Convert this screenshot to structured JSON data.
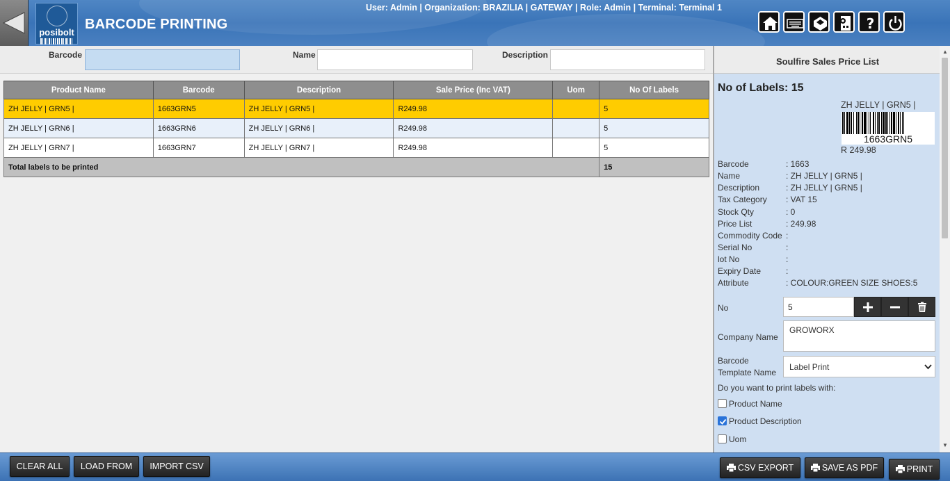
{
  "header": {
    "title": "BARCODE PRINTING",
    "logo_text": "posibolt",
    "user_info": "User: Admin | Organization: BRAZILIA | GATEWAY | Role: Admin | Terminal: Terminal 1",
    "icons": [
      "home-icon",
      "keyboard-icon",
      "catalog-icon",
      "calculator-settings-icon",
      "help-icon",
      "power-icon"
    ]
  },
  "filters": {
    "barcode_label": "Barcode",
    "barcode_value": "",
    "name_label": "Name",
    "name_value": "",
    "description_label": "Description",
    "description_value": ""
  },
  "grid": {
    "columns": [
      "Product Name",
      "Barcode",
      "Description",
      "Sale Price (Inc VAT)",
      "Uom",
      "No Of Labels"
    ],
    "rows": [
      {
        "product_name": "ZH JELLY | GRN5 |",
        "barcode": "1663GRN5",
        "description": "ZH JELLY | GRN5 |",
        "sale_price": "R249.98",
        "uom": "",
        "labels": "5"
      },
      {
        "product_name": "ZH JELLY | GRN6 |",
        "barcode": "1663GRN6",
        "description": "ZH JELLY | GRN6 |",
        "sale_price": "R249.98",
        "uom": "",
        "labels": "5"
      },
      {
        "product_name": "ZH JELLY | GRN7 |",
        "barcode": "1663GRN7",
        "description": "ZH JELLY | GRN7 |",
        "sale_price": "R249.98",
        "uom": "",
        "labels": "5"
      }
    ],
    "total_label": "Total labels to be printed",
    "total_value": "15",
    "selected_row_color": "#ffcc00"
  },
  "right_panel": {
    "title": "Soulfire Sales Price List",
    "labels_count": "No of Labels: 15",
    "preview": {
      "name": "ZH JELLY | GRN5 |",
      "code": "1663GRN5",
      "price": "R 249.98"
    },
    "info": [
      {
        "key": "Barcode",
        "value": ": 1663"
      },
      {
        "key": "Name",
        "value": ": ZH JELLY | GRN5 |"
      },
      {
        "key": "Description",
        "value": ": ZH JELLY | GRN5 |"
      },
      {
        "key": "Tax Category",
        "value": ": VAT 15"
      },
      {
        "key": "Stock Qty",
        "value": ": 0"
      },
      {
        "key": "Price List",
        "value": ": 249.98"
      },
      {
        "key": "Commodity Code",
        "value": ":"
      },
      {
        "key": "Serial No",
        "value": ":"
      },
      {
        "key": "lot No",
        "value": ":"
      },
      {
        "key": "Expiry Date",
        "value": ":"
      },
      {
        "key": "Attribute",
        "value": ": COLOUR:GREEN SIZE SHOES:5"
      }
    ],
    "no_label": "No",
    "no_value": "5",
    "company_label": "Company Name",
    "company_value": "GROWORX",
    "template_label_line1": "Barcode",
    "template_label_line2": "Template Name",
    "template_value": "Label Print",
    "print_with_label": "Do you want to print labels with:",
    "checkboxes": [
      {
        "label": "Product Name",
        "checked": false
      },
      {
        "label": "Product Description",
        "checked": true
      },
      {
        "label": "Uom",
        "checked": false
      }
    ]
  },
  "footer": {
    "clear_all": "CLEAR ALL",
    "load_from": "LOAD FROM",
    "import_csv": "IMPORT CSV",
    "csv_export": "CSV EXPORT",
    "save_as_pdf": "SAVE AS PDF",
    "print": "PRINT"
  }
}
